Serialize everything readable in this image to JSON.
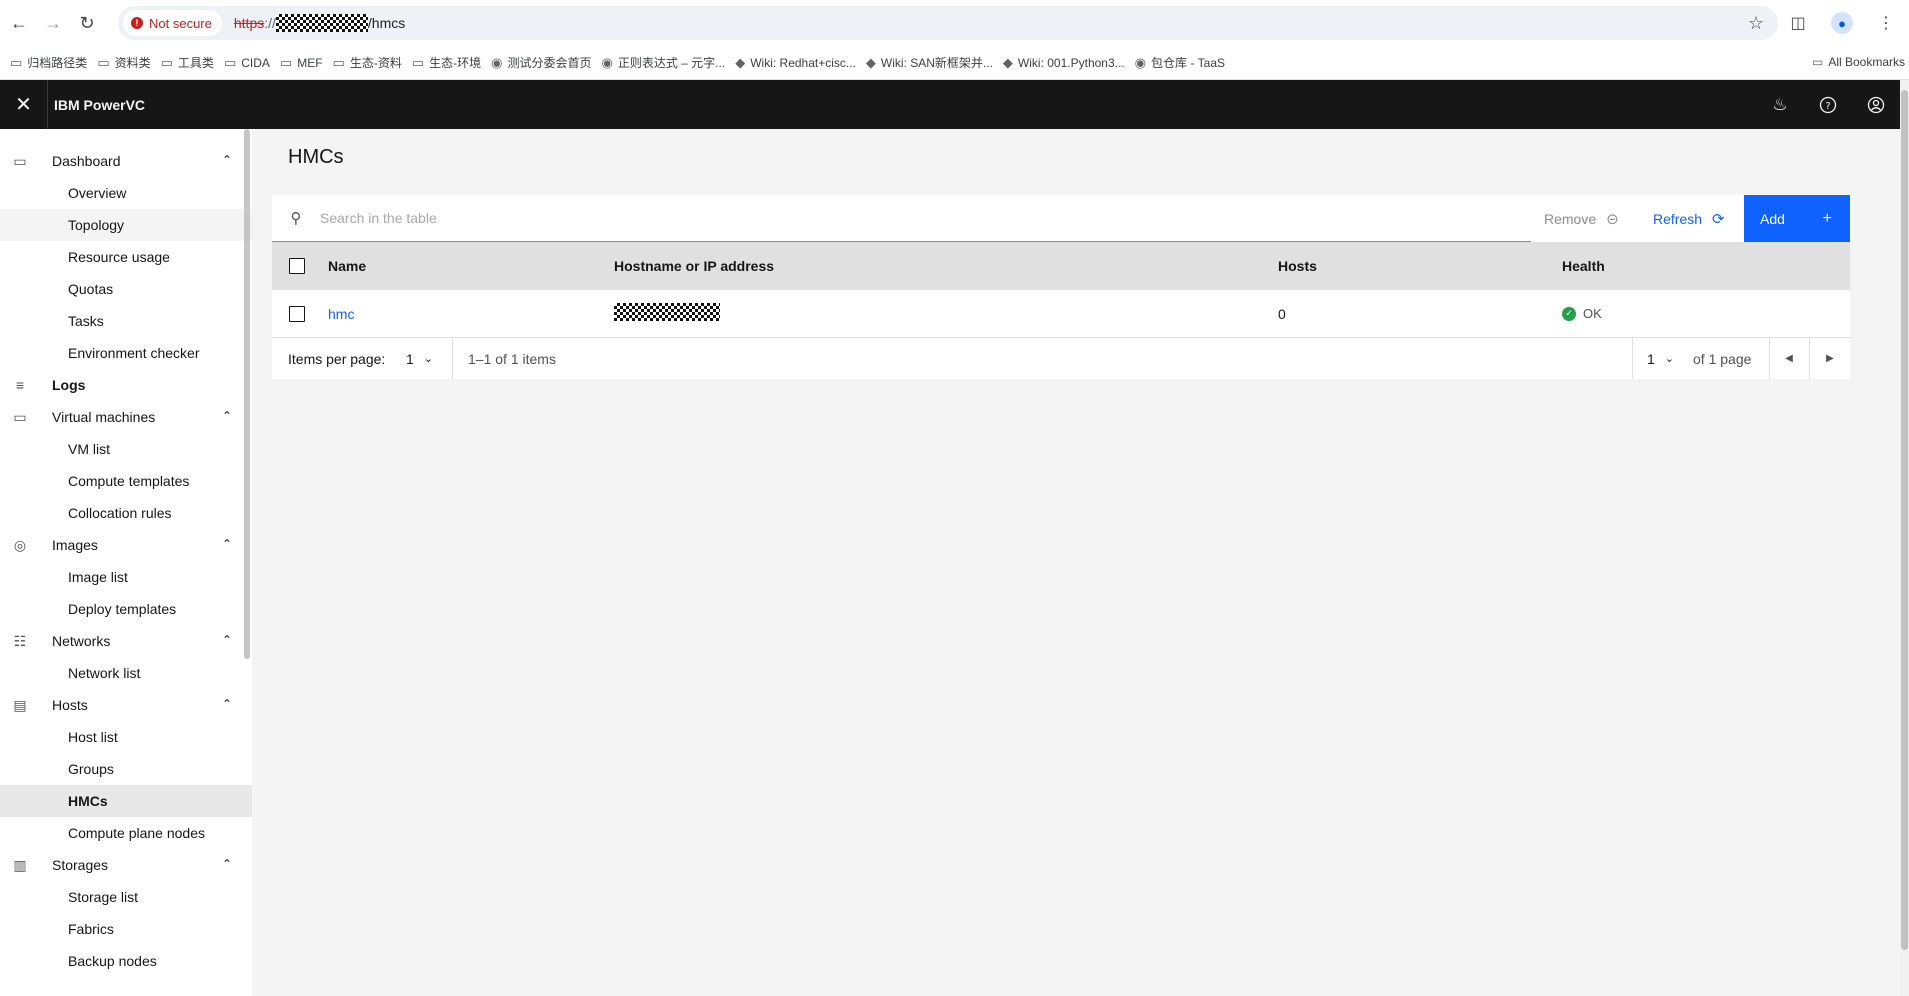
{
  "browser": {
    "security_label": "Not secure",
    "url_scheme": "https",
    "url_sep": "://",
    "url_path": "/hmcs",
    "bookmarks": [
      {
        "label": "归档路径类",
        "icon": "folder-icon"
      },
      {
        "label": "资料类",
        "icon": "folder-icon"
      },
      {
        "label": "工具类",
        "icon": "folder-icon"
      },
      {
        "label": "CIDA",
        "icon": "folder-icon"
      },
      {
        "label": "MEF",
        "icon": "folder-icon"
      },
      {
        "label": "生态-资料",
        "icon": "folder-icon"
      },
      {
        "label": "生态-环境",
        "icon": "folder-icon"
      },
      {
        "label": "测试分委会首页",
        "icon": "page-icon"
      },
      {
        "label": "正则表达式 – 元字...",
        "icon": "page-icon"
      },
      {
        "label": "Wiki: Redhat+cisc...",
        "icon": "wiki-icon"
      },
      {
        "label": "Wiki: SAN新框架并...",
        "icon": "wiki-icon"
      },
      {
        "label": "Wiki: 001.Python3...",
        "icon": "wiki-icon"
      },
      {
        "label": "包仓库 - TaaS",
        "icon": "page-icon"
      }
    ],
    "all_bookmarks": "All Bookmarks"
  },
  "header": {
    "brand": "IBM PowerVC"
  },
  "sidebar": {
    "groups": [
      {
        "label": "Dashboard",
        "icon": "monitor-icon",
        "items": [
          "Overview",
          "Topology",
          "Resource usage",
          "Quotas",
          "Tasks",
          "Environment checker"
        ]
      },
      {
        "label": "Logs",
        "icon": "log-icon",
        "items": []
      },
      {
        "label": "Virtual machines",
        "icon": "monitor-icon",
        "items": [
          "VM list",
          "Compute templates",
          "Collocation rules"
        ]
      },
      {
        "label": "Images",
        "icon": "camera-icon",
        "items": [
          "Image list",
          "Deploy templates"
        ]
      },
      {
        "label": "Networks",
        "icon": "network-icon",
        "items": [
          "Network list"
        ]
      },
      {
        "label": "Hosts",
        "icon": "server-icon",
        "items": [
          "Host list",
          "Groups",
          "HMCs",
          "Compute plane nodes"
        ]
      },
      {
        "label": "Storages",
        "icon": "storage-icon",
        "items": [
          "Storage list",
          "Fabrics",
          "Backup nodes"
        ]
      }
    ],
    "active_item": "HMCs"
  },
  "main": {
    "title": "HMCs",
    "search_placeholder": "Search in the table",
    "remove_label": "Remove",
    "refresh_label": "Refresh",
    "add_label": "Add",
    "columns": [
      "Name",
      "Hostname or IP address",
      "Hosts",
      "Health"
    ],
    "rows": [
      {
        "name": "hmc",
        "hosts": "0",
        "health": "OK"
      }
    ],
    "pagination": {
      "items_per_page_label": "Items per page:",
      "items_per_page": "1",
      "range": "1–1 of 1 items",
      "page": "1",
      "of_pages": "of 1 page"
    }
  },
  "colors": {
    "accent": "#0f62fe",
    "header_bg": "#161616",
    "ok": "#24a148"
  }
}
